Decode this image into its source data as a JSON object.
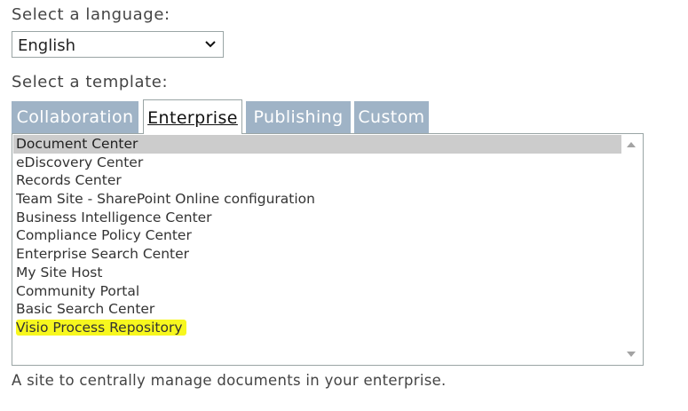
{
  "language": {
    "label": "Select a language:",
    "selected": "English"
  },
  "template": {
    "label": "Select a template:",
    "tabs": [
      {
        "label": "Collaboration",
        "active": false
      },
      {
        "label": "Enterprise",
        "active": true
      },
      {
        "label": "Publishing",
        "active": false
      },
      {
        "label": "Custom",
        "active": false
      }
    ],
    "items": [
      "Document Center",
      "eDiscovery Center",
      "Records Center",
      "Team Site - SharePoint Online configuration",
      "Business Intelligence Center",
      "Compliance Policy Center",
      "Enterprise Search Center",
      "My Site Host",
      "Community Portal",
      "Basic Search Center",
      "Visio Process Repository"
    ],
    "selected_index": 0,
    "highlighted_index": 10,
    "description": "A site to centrally manage documents in your enterprise."
  },
  "colors": {
    "tab_inactive": "#9fb3c6",
    "selected_row": "#cccccc",
    "highlight": "#f7f71e"
  }
}
